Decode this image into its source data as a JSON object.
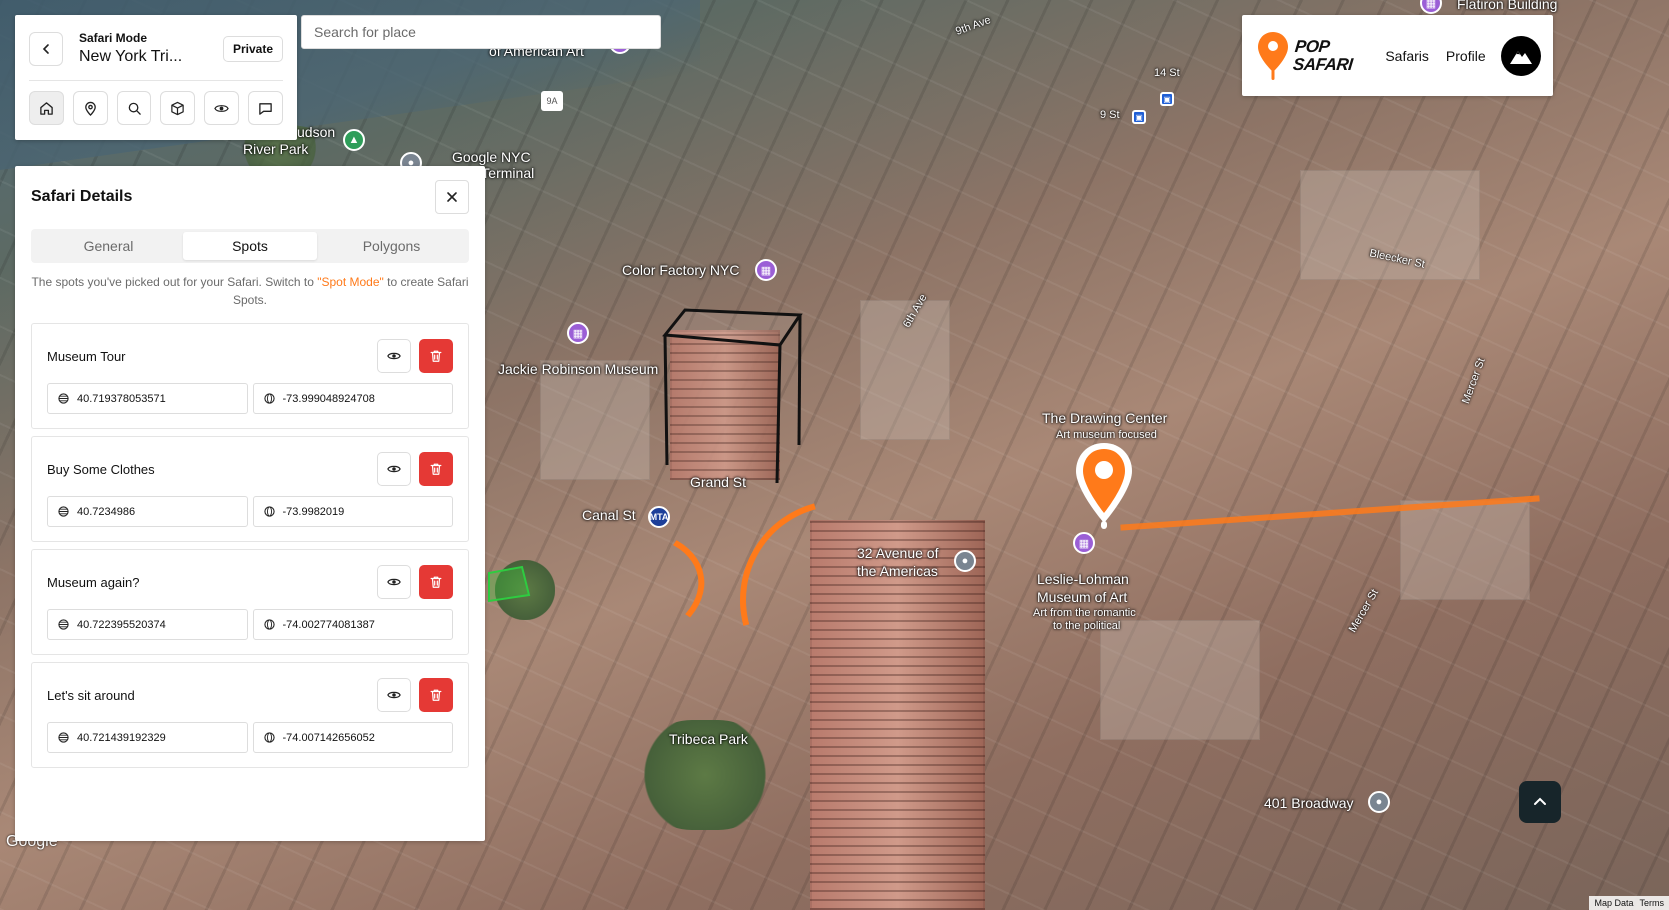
{
  "mode": {
    "subtitle": "Safari Mode",
    "trip_name": "New York Tri...",
    "privacy_label": "Private"
  },
  "search": {
    "placeholder": "Search for place"
  },
  "brand": {
    "logo_line1": "POP",
    "logo_line2": "SAFARI",
    "nav": [
      "Safaris",
      "Profile"
    ],
    "accent": "#ff7a1a"
  },
  "details": {
    "title": "Safari Details",
    "tabs": [
      "General",
      "Spots",
      "Polygons"
    ],
    "active_tab": "Spots",
    "desc_before": "The spots you've picked out for your Safari. Switch to ",
    "desc_link": "\"Spot Mode\"",
    "desc_after": " to create Safari Spots.",
    "spots": [
      {
        "name": "Museum Tour",
        "lat": "40.719378053571",
        "lng": "-73.999048924708"
      },
      {
        "name": "Buy Some Clothes",
        "lat": "40.7234986",
        "lng": "-73.9982019"
      },
      {
        "name": "Museum again?",
        "lat": "40.722395520374",
        "lng": "-74.002774081387"
      },
      {
        "name": "Let's sit around",
        "lat": "40.721439192329",
        "lng": "-74.007142656052"
      }
    ]
  },
  "map": {
    "labels": {
      "color_factory": "Color Factory NYC",
      "jackie": "Jackie Robinson Museum",
      "grand_st": "Grand St",
      "canal_st": "Canal St",
      "drawing_center": "The Drawing Center",
      "drawing_center_sub": "Art museum focused",
      "ave_americas_1": "32 Avenue of",
      "ave_americas_2": "the Americas",
      "leslie_1": "Leslie-Lohman",
      "leslie_2": "Museum of Art",
      "leslie_3": "Art from the romantic",
      "leslie_4": "to the political",
      "tribeca": "Tribeca Park",
      "broadway": "401 Broadway",
      "google_nyc": "Google NYC",
      "terminal": "'s Terminal",
      "hudson": "udson",
      "river_park": "River Park",
      "american_art": "of American Art",
      "flatiron": "Flatiron Building",
      "st14": "14 St",
      "st9": "9 St",
      "ave9": "9th Ave",
      "ave6": "6th Ave",
      "bleecker": "Bleecker St",
      "mercer1": "Mercer St",
      "mercer2": "Mercer St",
      "route_9a": "9A"
    },
    "google": "Google",
    "attrib_data": "Map Data",
    "attrib_terms": "Terms"
  }
}
